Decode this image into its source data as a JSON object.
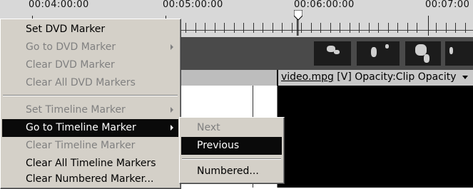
{
  "ruler": {
    "labels": [
      "00:04:00:00",
      "00:05:00:00",
      "00:06:00:00",
      "00:07:00"
    ]
  },
  "clip": {
    "name": "video.mpg",
    "suffix": " [V] Opacity:Clip Opacity"
  },
  "main_menu": {
    "items": [
      {
        "label": "Set DVD Marker",
        "enabled": true
      },
      {
        "label": "Go to DVD Marker",
        "enabled": false,
        "submenu": true
      },
      {
        "label": "Clear DVD Marker",
        "enabled": false
      },
      {
        "label": "Clear All DVD Markers",
        "enabled": false
      },
      {
        "label": "Set Timeline Marker",
        "enabled": false,
        "submenu": true
      },
      {
        "label": "Go to Timeline Marker",
        "enabled": true,
        "submenu": true,
        "selected": true
      },
      {
        "label": "Clear Timeline Marker",
        "enabled": false
      },
      {
        "label": "Clear All Timeline Markers",
        "enabled": true
      },
      {
        "label": "Clear Numbered Marker...",
        "enabled": true
      }
    ]
  },
  "sub_menu": {
    "items": [
      {
        "label": "Next",
        "enabled": false
      },
      {
        "label": "Previous",
        "enabled": true,
        "selected": true
      },
      {
        "label": "Numbered...",
        "enabled": true
      }
    ]
  },
  "colors": {
    "menu_bg": "#d4d0c8",
    "highlight": "#0a0a0a",
    "disabled_text": "#808080"
  }
}
